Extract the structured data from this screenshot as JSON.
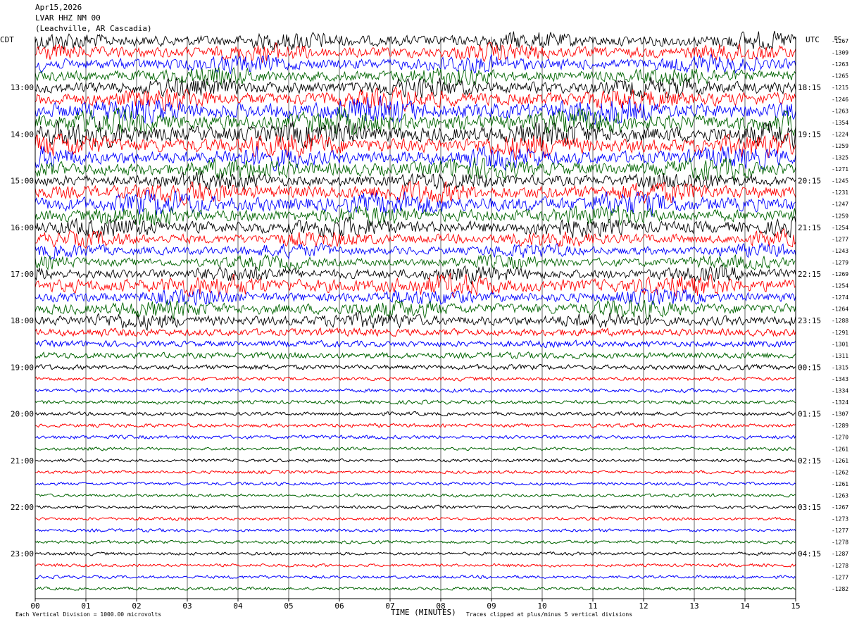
{
  "header": {
    "date": "Apr15,2026",
    "station": "LVAR HHZ NM 00",
    "location": "(Leachville, AR Cascadia)"
  },
  "left_tz": "CDT",
  "right_tz": "UTC",
  "dc_label": "DC",
  "footer": {
    "division_note": "Each Vertical Division = 1000.00 microvolts",
    "xlabel": "TIME (MINUTES)",
    "clip_note": "Traces clipped at plus/minus 5 vertical divisions"
  },
  "chart_data": {
    "type": "helicorder",
    "title": "LVAR HHZ NM 00",
    "xlabel": "TIME (MINUTES)",
    "xlim": [
      0,
      15
    ],
    "x_ticks": [
      "00",
      "01",
      "02",
      "03",
      "04",
      "05",
      "06",
      "07",
      "08",
      "09",
      "10",
      "11",
      "12",
      "13",
      "14",
      "15"
    ],
    "colors": [
      "#000000",
      "#ff0000",
      "#0000ff",
      "#006400"
    ],
    "left_time_labels": [
      "13:00",
      "14:00",
      "15:00",
      "16:00",
      "17:00",
      "18:00",
      "19:00",
      "20:00",
      "21:00",
      "22:00",
      "23:00"
    ],
    "right_time_labels": [
      "18:15",
      "19:15",
      "20:15",
      "21:15",
      "22:15",
      "23:15",
      "00:15",
      "01:15",
      "02:15",
      "03:15",
      "04:15"
    ],
    "dc_offsets": [
      -1267,
      -1309,
      -1263,
      -1265,
      -1215,
      -1246,
      -1263,
      -1354,
      -1224,
      -1259,
      -1325,
      -1271,
      -1245,
      -1231,
      -1247,
      -1259,
      -1254,
      -1277,
      -1243,
      -1279,
      -1269,
      -1254,
      -1274,
      -1264,
      -1288,
      -1291,
      -1301,
      -1311,
      -1315,
      -1343,
      -1334,
      -1324,
      -1307,
      -1289,
      -1270,
      -1261,
      -1261,
      -1262,
      -1261,
      -1263,
      -1267,
      -1273,
      -1277,
      -1278,
      -1287,
      -1278,
      -1277,
      -1282
    ],
    "trace_amplitude": [
      9,
      9,
      9,
      9,
      10,
      11,
      13,
      13,
      13,
      12,
      11,
      11,
      9,
      11,
      12,
      10,
      10,
      8,
      7,
      7,
      8,
      11,
      8,
      9,
      8,
      6,
      5,
      5,
      4,
      3,
      3,
      3,
      3,
      3,
      3,
      2.5,
      2.5,
      2.5,
      2.5,
      2.5,
      2.5,
      2.5,
      2.5,
      2.5,
      2.5,
      2.5,
      2.5,
      2.5
    ],
    "units": "microvolts",
    "division": 1000
  }
}
